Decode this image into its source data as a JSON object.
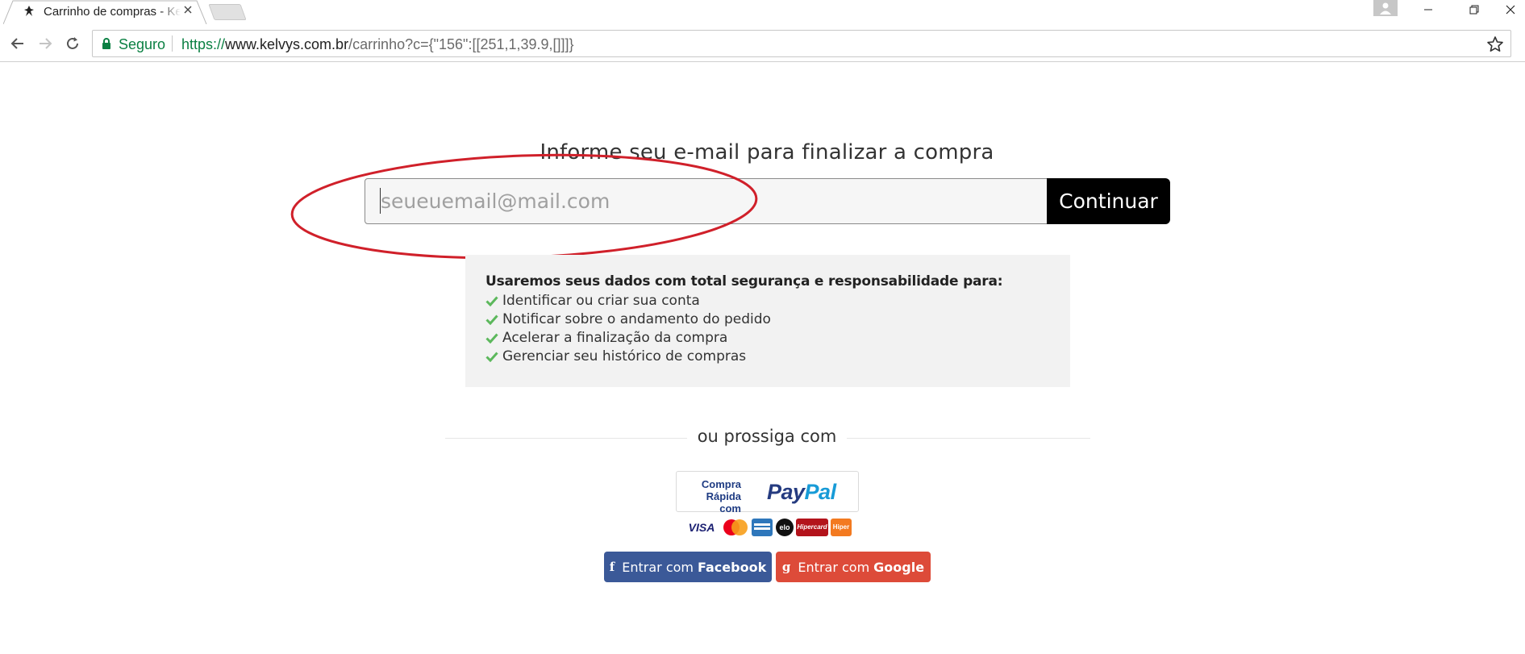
{
  "browser": {
    "tab_title": "Carrinho de compras - Kelvys",
    "tab_favicon": "kelvys-logo-icon",
    "secure_label": "Seguro",
    "url_scheme": "https://",
    "url_host": "www.kelvys.com.br",
    "url_path": "/carrinho?c={\"156\":[[251,1,39.9,[]]]}"
  },
  "checkout": {
    "heading": "Informe seu e-mail para finalizar a compra",
    "email_placeholder": "seueuemail@mail.com",
    "email_value": "",
    "continue_label": "Continuar",
    "annotation_color": "#d0202a"
  },
  "info": {
    "title": "Usaremos seus dados com total segurança e responsabilidade para:",
    "items": [
      "Identificar ou criar sua conta",
      "Notificar sobre o andamento do pedido",
      "Acelerar a finalização da compra",
      "Gerenciar seu histórico de compras"
    ],
    "check_color": "#5cb85c"
  },
  "alternatives": {
    "divider_label": "ou prossiga com",
    "paypal_caption_line1": "Compra",
    "paypal_caption_line2": "Rápida com",
    "paypal_logo_pay": "Pay",
    "paypal_logo_pal": "Pal",
    "cards": [
      "VISA",
      "MasterCard",
      "American Express",
      "elo",
      "Hipercard",
      "Hiper"
    ],
    "facebook_prefix": "Entrar com",
    "facebook_brand": "Facebook",
    "google_prefix": "Entrar com",
    "google_brand": "Google",
    "facebook_color": "#3b5998",
    "google_color": "#dd4b39"
  }
}
